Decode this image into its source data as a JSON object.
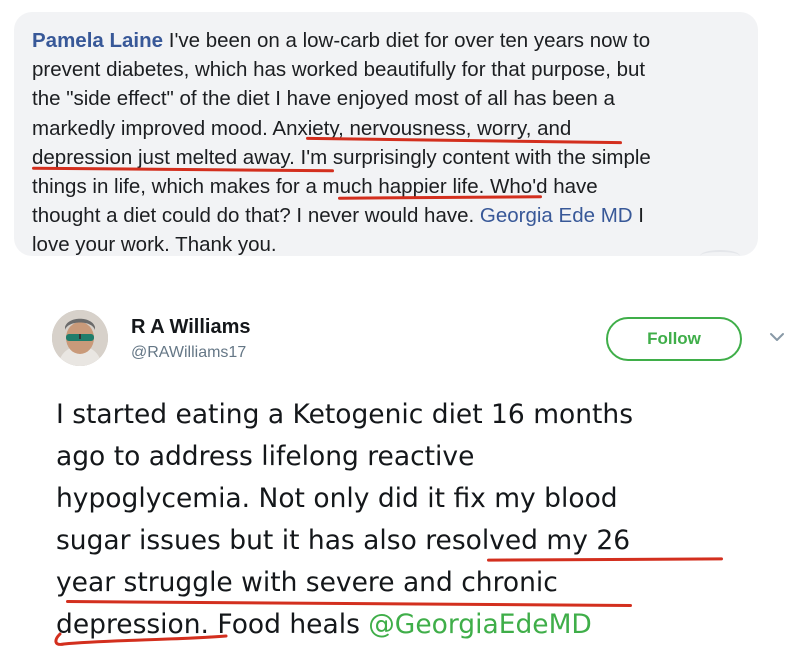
{
  "facebook_comment": {
    "author": "Pamela Laine",
    "lines": [
      " I've been on a low-carb diet for over ten years now to",
      "prevent diabetes, which has worked beautifully for that purpose, but",
      "the \"side effect\" of the diet I have enjoyed most of all has been a",
      "markedly improved mood. Anxiety, nervousness, worry, and",
      "depression just melted away. I'm surprisingly content with the simple",
      "things in life, which makes for a much happier life. Who'd have",
      "thought a diet could do that? I never would have. "
    ],
    "mention": "Georgia Ede MD",
    "line7_after_mention": " I",
    "last_line": "love your work. Thank you."
  },
  "tweet": {
    "name": "R A Williams",
    "handle": "@RAWilliams17",
    "follow_label": "Follow",
    "lines": [
      "I started eating a Ketogenic diet 16 months",
      "ago to address lifelong reactive",
      "hypoglycemia. Not only did it fix my blood",
      "sugar issues but it has also resolved  my 26",
      "year struggle with severe and chronic",
      "depression. Food heals "
    ],
    "mention": "@GeorgiaEdeMD"
  },
  "colors": {
    "underline": "#d32f1e",
    "fb_link": "#385898",
    "tweet_accent": "#3fae49"
  }
}
